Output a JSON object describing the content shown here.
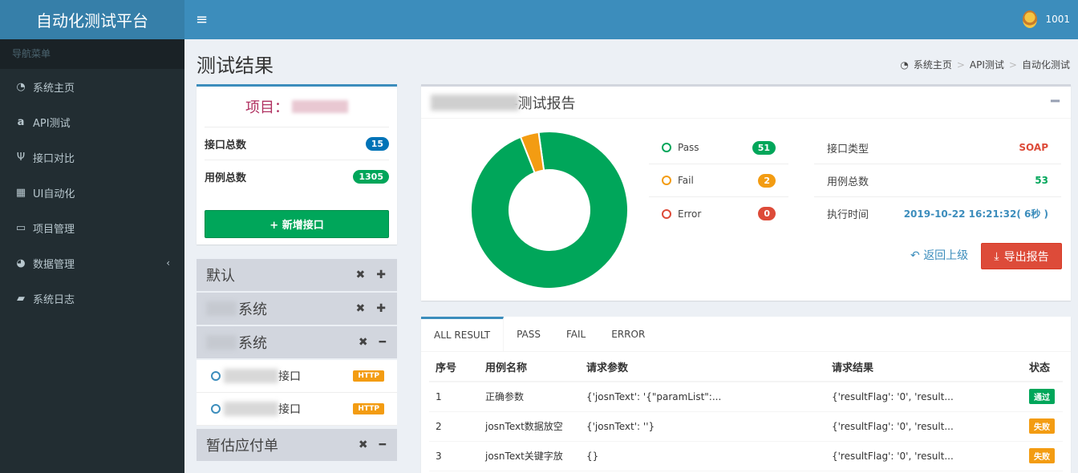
{
  "app": {
    "brand": "自动化测试平台",
    "user": "1001"
  },
  "sidebar": {
    "header": "导航菜单",
    "items": [
      {
        "label": "系统主页",
        "icon": "dashboard-icon"
      },
      {
        "label": "API测试",
        "icon": "amazon-icon"
      },
      {
        "label": "接口对比",
        "icon": "cutlery-icon"
      },
      {
        "label": "UI自动化",
        "icon": "grid-icon"
      },
      {
        "label": "项目管理",
        "icon": "laptop-icon"
      },
      {
        "label": "数据管理",
        "icon": "pie-chart-icon"
      },
      {
        "label": "系统日志",
        "icon": "book-icon"
      }
    ]
  },
  "page": {
    "title": "测试结果"
  },
  "breadcrumb": [
    "系统主页",
    "API测试",
    "自动化测试"
  ],
  "summary": {
    "project_label": "项目：",
    "interface_total_label": "接口总数",
    "interface_total": "15",
    "case_total_label": "用例总数",
    "case_total": "1305",
    "add_button": "+ 新增接口"
  },
  "groups": [
    {
      "name": "默认",
      "expanded": false
    },
    {
      "name": "系统",
      "expanded": false
    },
    {
      "name": "系统",
      "expanded": true,
      "items": [
        {
          "name": "接口",
          "tag": "HTTP"
        },
        {
          "name": "接口",
          "tag": "HTTP"
        }
      ]
    },
    {
      "name": "暂估应付单",
      "expanded": true
    }
  ],
  "report": {
    "title": "-测试报告",
    "legend": [
      {
        "label": "Pass",
        "count": "51",
        "color": "#00a65a"
      },
      {
        "label": "Fail",
        "count": "2",
        "color": "#f39c12"
      },
      {
        "label": "Error",
        "count": "0",
        "color": "#dd4b39"
      }
    ],
    "info": [
      {
        "label": "接口类型",
        "value": "SOAP"
      },
      {
        "label": "用例总数",
        "value": "53"
      },
      {
        "label": "执行时间",
        "value": "2019-10-22 16:21:32( 6秒 )"
      }
    ],
    "back_label": "返回上级",
    "export_label": "导出报告"
  },
  "chart_data": {
    "type": "pie",
    "categories": [
      "Pass",
      "Fail",
      "Error"
    ],
    "values": [
      51,
      2,
      0
    ],
    "colors": [
      "#00a65a",
      "#f39c12",
      "#dd4b39"
    ]
  },
  "results": {
    "tabs": [
      "ALL RESULT",
      "PASS",
      "FAIL",
      "ERROR"
    ],
    "columns": [
      "序号",
      "用例名称",
      "请求参数",
      "请求结果",
      "状态"
    ],
    "rows": [
      {
        "no": "1",
        "name": "正确参数",
        "params": "{'josnText': '{\"paramList\":...",
        "result": "{'resultFlag': '0', 'result...",
        "status": "通过",
        "status_color": "#00a65a"
      },
      {
        "no": "2",
        "name": "josnText数据放空",
        "params": "{'josnText': ''}",
        "result": "{'resultFlag': '0', 'result...",
        "status": "失败",
        "status_color": "#f39c12"
      },
      {
        "no": "3",
        "name": "josnText关键字放",
        "params": "{}",
        "result": "{'resultFlag': '0', 'result...",
        "status": "失败",
        "status_color": "#f39c12"
      }
    ]
  }
}
